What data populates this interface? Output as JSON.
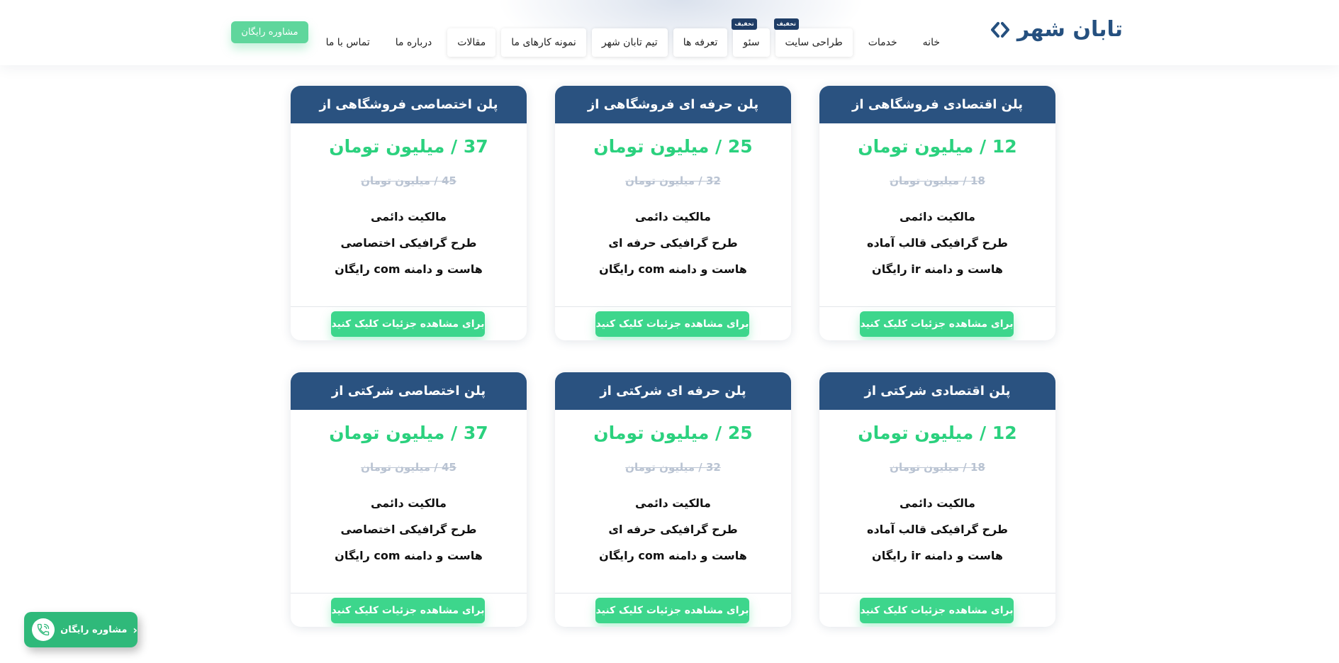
{
  "header": {
    "brand": "تابان شهر",
    "nav": [
      {
        "label": "خانه",
        "badge": ""
      },
      {
        "label": "خدمات",
        "badge": ""
      },
      {
        "label": "طراحی سایت",
        "badge": "تخفیف"
      },
      {
        "label": "سئو",
        "badge": "تخفیف"
      },
      {
        "label": "تعرفه ها",
        "badge": ""
      },
      {
        "label": "تیم تابان شهر",
        "badge": ""
      },
      {
        "label": "نمونه کارهای ما",
        "badge": ""
      },
      {
        "label": "مقالات",
        "badge": ""
      },
      {
        "label": "درباره ما",
        "badge": ""
      },
      {
        "label": "تماس با ما",
        "badge": ""
      }
    ],
    "consult_label": "مشاوره رایگان"
  },
  "plans": [
    {
      "title": "پلن اقتصادی فروشگاهی از",
      "price": "12 / میلیون تومان",
      "old_price": "18 / میلیون تومان",
      "features": [
        "مالکیت دائمی",
        "طرح گرافیکی قالب آماده",
        "هاست و دامنه ir رایگان"
      ],
      "button": "برای مشاهده جزئیات کلیک کنید"
    },
    {
      "title": "پلن حرفه ای فروشگاهی از",
      "price": "25 / میلیون تومان",
      "old_price": "32 / میلیون تومان",
      "features": [
        "مالکیت دائمی",
        "طرح گرافیکی حرفه ای",
        "هاست و دامنه com رایگان"
      ],
      "button": "برای مشاهده جزئیات کلیک کنید"
    },
    {
      "title": "پلن اختصاصی فروشگاهی از",
      "price": "37 / میلیون تومان",
      "old_price": "45 / میلیون تومان",
      "features": [
        "مالکیت دائمی",
        "طرح گرافیکی اختصاصی",
        "هاست و دامنه com رایگان"
      ],
      "button": "برای مشاهده جزئیات کلیک کنید"
    },
    {
      "title": "پلن اقتصادی شرکتی از",
      "price": "12 / میلیون تومان",
      "old_price": "18 / میلیون تومان",
      "features": [
        "مالکیت دائمی",
        "طرح گرافیکی قالب آماده",
        "هاست و دامنه ir رایگان"
      ],
      "button": "برای مشاهده جزئیات کلیک کنید"
    },
    {
      "title": "پلن حرفه ای شرکتی از",
      "price": "25 / میلیون تومان",
      "old_price": "32 / میلیون تومان",
      "features": [
        "مالکیت دائمی",
        "طرح گرافیکی حرفه ای",
        "هاست و دامنه com رایگان"
      ],
      "button": "برای مشاهده جزئیات کلیک کنید"
    },
    {
      "title": "پلن اختصاصی شرکتی از",
      "price": "37 / میلیون تومان",
      "old_price": "45 / میلیون تومان",
      "features": [
        "مالکیت دائمی",
        "طرح گرافیکی اختصاصی",
        "هاست و دامنه com رایگان"
      ],
      "button": "برای مشاهده جزئیات کلیک کنید"
    }
  ],
  "floating": {
    "label": "مشاوره رایگان",
    "chevron": "‹",
    "icon": "phone-icon"
  },
  "colors": {
    "brand": "#25507f",
    "card_header": "#2a5280",
    "accent_green": "#3dd68c",
    "price_green": "#2bd17e",
    "badge": "#1f3d66"
  }
}
